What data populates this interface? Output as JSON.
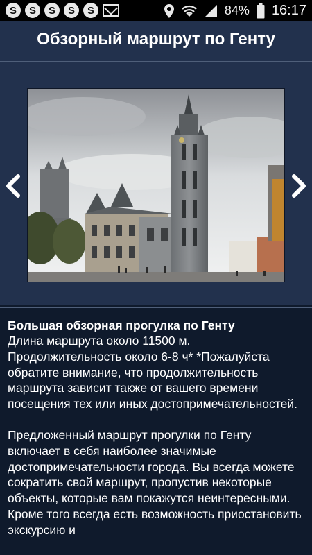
{
  "status_bar": {
    "notification_badges": [
      "S",
      "S",
      "S",
      "S",
      "S"
    ],
    "battery": "84%",
    "time": "16:17"
  },
  "header": {
    "title": "Обзорный маршрут по Генту"
  },
  "gallery": {
    "image_name": "ghent-belfry-photo",
    "prev_icon": "chevron-left-icon",
    "next_icon": "chevron-right-icon"
  },
  "description": {
    "title": "Большая обзорная прогулка по Генту",
    "paragraph1": "Длина маршрута около 11500 м. Продолжительность около 6-8 ч* *Пожалуйста обратите внимание, что продолжительность маршрута зависит также от вашего времени посещения тех или иных достопримечательностей.",
    "paragraph2": "Предложенный маршрут прогулки по Генту включает в себя наиболее значимые достопримечательности города. Вы всегда можете сократить свой маршрут, пропустив некоторые объекты, которые вам покажутся неинтересными. Кроме того всегда есть возможность приостановить экскурсию и"
  },
  "colors": {
    "header_bg": "#22314d",
    "content_bg": "#0f1a2c",
    "divider": "#4f5f7a",
    "text": "#ffffff"
  }
}
